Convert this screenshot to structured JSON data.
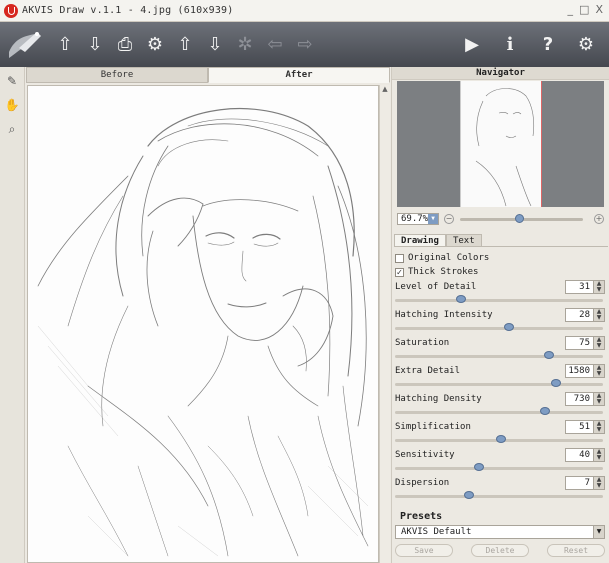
{
  "window": {
    "title": "AKVIS Draw v.1.1 - 4.jpg (610x939)",
    "controls": [
      "_",
      "□",
      "X"
    ]
  },
  "toolbar": {
    "left_buttons": [
      {
        "name": "open-image",
        "icon": "upload-tray-icon",
        "glyph": "⇧"
      },
      {
        "name": "save-image",
        "icon": "download-tray-icon",
        "glyph": "⇩"
      },
      {
        "name": "print-image",
        "icon": "printer-icon",
        "glyph": "⎙"
      },
      {
        "name": "share",
        "icon": "share-icon",
        "glyph": "⚙"
      },
      {
        "name": "load-settings",
        "icon": "load-settings-icon",
        "glyph": "⇧"
      },
      {
        "name": "save-settings",
        "icon": "save-settings-icon",
        "glyph": "⇩"
      },
      {
        "name": "preferences",
        "icon": "gears-icon",
        "glyph": "✲"
      },
      {
        "name": "undo",
        "icon": "arrow-left-icon",
        "glyph": "⇦"
      },
      {
        "name": "redo",
        "icon": "arrow-right-icon",
        "glyph": "⇨"
      }
    ],
    "right_buttons": [
      {
        "name": "run",
        "icon": "play-icon",
        "glyph": "▶"
      },
      {
        "name": "info",
        "icon": "info-icon",
        "glyph": "i"
      },
      {
        "name": "help",
        "icon": "help-icon",
        "glyph": "?"
      },
      {
        "name": "settings",
        "icon": "gear-icon",
        "glyph": "⚙"
      }
    ]
  },
  "tools": [
    {
      "name": "pencil-tool",
      "icon": "pencil-icon",
      "glyph": "✎"
    },
    {
      "name": "hand-tool",
      "icon": "hand-icon",
      "glyph": "✋"
    },
    {
      "name": "zoom-tool",
      "icon": "magnifier-icon",
      "glyph": "⌕"
    }
  ],
  "view_tabs": {
    "before": "Before",
    "after": "After",
    "active": "after"
  },
  "navigator": {
    "title": "Navigator",
    "zoom": "69.7%",
    "zoom_level": 0.45
  },
  "settings_tabs": {
    "drawing": "Drawing",
    "text": "Text",
    "active": "drawing"
  },
  "options": {
    "original_colors": {
      "label": "Original Colors",
      "checked": false
    },
    "thick_strokes": {
      "label": "Thick Strokes",
      "checked": true
    }
  },
  "params": [
    {
      "label": "Level of Detail",
      "value": "31",
      "fraction": 0.31
    },
    {
      "label": "Hatching Intensity",
      "value": "28",
      "fraction": 0.55
    },
    {
      "label": "Saturation",
      "value": "75",
      "fraction": 0.75
    },
    {
      "label": "Extra Detail",
      "value": "1580",
      "fraction": 0.79
    },
    {
      "label": "Hatching Density",
      "value": "730",
      "fraction": 0.73
    },
    {
      "label": "Simplification",
      "value": "51",
      "fraction": 0.51
    },
    {
      "label": "Sensitivity",
      "value": "40",
      "fraction": 0.4
    },
    {
      "label": "Dispersion",
      "value": "7",
      "fraction": 0.35
    }
  ],
  "presets": {
    "title": "Presets",
    "selected": "AKVIS Default",
    "buttons": {
      "save": "Save",
      "delete": "Delete",
      "reset": "Reset"
    }
  },
  "colors": {
    "toolbar": "#55585f",
    "accent": "#7e9cc3",
    "logo": "#d6271f"
  }
}
